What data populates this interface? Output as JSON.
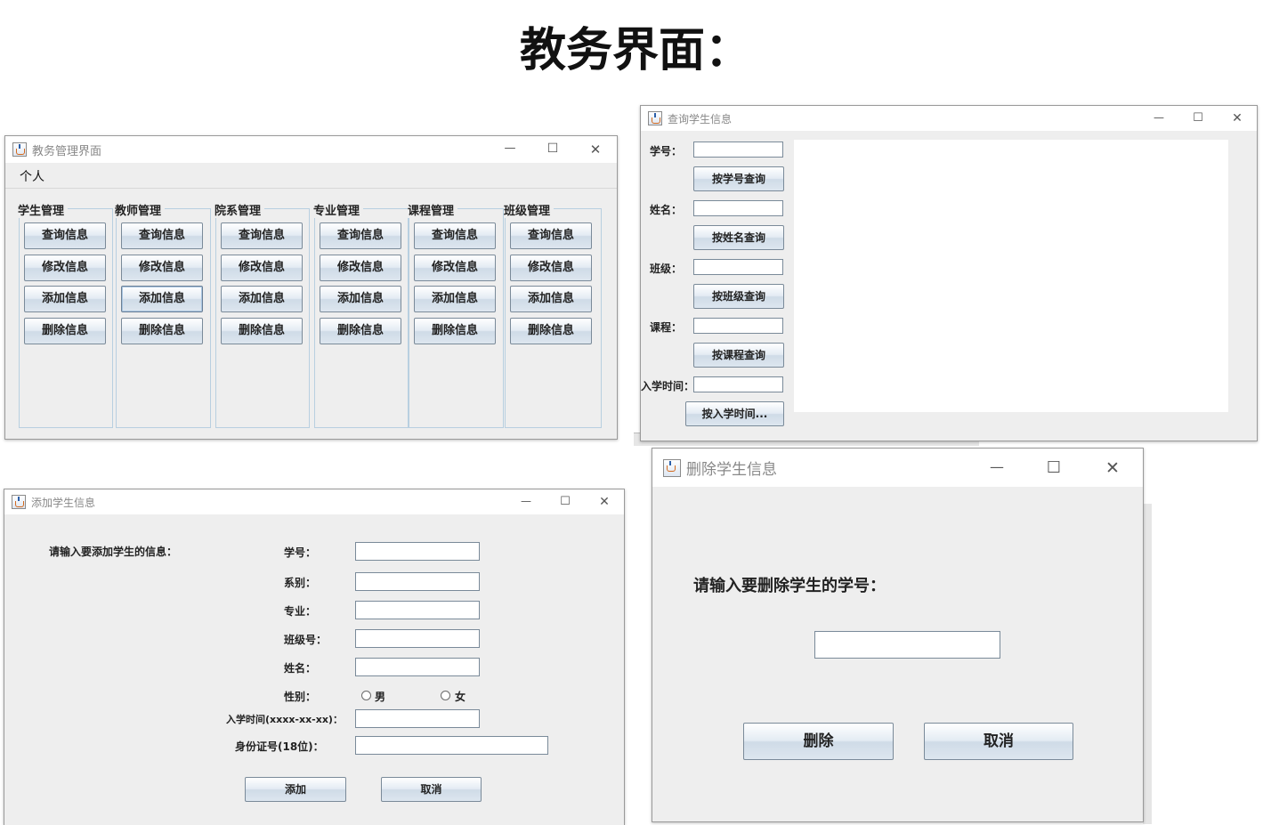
{
  "page": {
    "title": "教务界面："
  },
  "main_window": {
    "title": "教务管理界面",
    "menu": [
      "个人"
    ],
    "groups": [
      {
        "title": "学生管理",
        "buttons": [
          "查询信息",
          "修改信息",
          "添加信息",
          "删除信息"
        ]
      },
      {
        "title": "教师管理",
        "buttons": [
          "查询信息",
          "修改信息",
          "添加信息",
          "删除信息"
        ]
      },
      {
        "title": "院系管理",
        "buttons": [
          "查询信息",
          "修改信息",
          "添加信息",
          "删除信息"
        ]
      },
      {
        "title": "专业管理",
        "buttons": [
          "查询信息",
          "修改信息",
          "添加信息",
          "删除信息"
        ]
      },
      {
        "title": "课程管理",
        "buttons": [
          "查询信息",
          "修改信息",
          "添加信息",
          "删除信息"
        ]
      },
      {
        "title": "班级管理",
        "buttons": [
          "查询信息",
          "修改信息",
          "添加信息",
          "删除信息"
        ]
      }
    ],
    "focused_button": {
      "group": 1,
      "button": 2
    }
  },
  "query_window": {
    "title": "查询学生信息",
    "fields": [
      {
        "label": "学号：",
        "value": "",
        "button": "按学号查询"
      },
      {
        "label": "姓名：",
        "value": "",
        "button": "按姓名查询"
      },
      {
        "label": "班级：",
        "value": "",
        "button": "按班级查询"
      },
      {
        "label": "课程：",
        "value": "",
        "button": "按课程查询"
      },
      {
        "label": "入学时间：",
        "value": "",
        "button": "按入学时间..."
      }
    ],
    "results": ""
  },
  "add_window": {
    "title": "添加学生信息",
    "prompt": "请输入要添加学生的信息：",
    "fields": [
      {
        "label": "学号：",
        "value": ""
      },
      {
        "label": "系别：",
        "value": ""
      },
      {
        "label": "专业：",
        "value": ""
      },
      {
        "label": "班级号：",
        "value": ""
      },
      {
        "label": "姓名：",
        "value": ""
      }
    ],
    "gender": {
      "label": "性别：",
      "options": [
        "男",
        "女"
      ],
      "selected": null
    },
    "enroll": {
      "label": "入学时间(xxxx-xx-xx)：",
      "value": ""
    },
    "idcard": {
      "label": "身份证号(18位)：",
      "value": ""
    },
    "add_button": "添加",
    "cancel_button": "取消"
  },
  "delete_window": {
    "title": "删除学生信息",
    "prompt": "请输入要删除学生的学号：",
    "value": "",
    "delete_button": "删除",
    "cancel_button": "取消"
  },
  "icons": {
    "app": "java-coffee-cup-icon",
    "minimize": "minimize-icon",
    "maximize": "maximize-icon",
    "close": "close-icon",
    "radio": "radio-button-icon"
  },
  "controls": {
    "minimize": "—",
    "maximize": "☐",
    "close": "✕"
  }
}
